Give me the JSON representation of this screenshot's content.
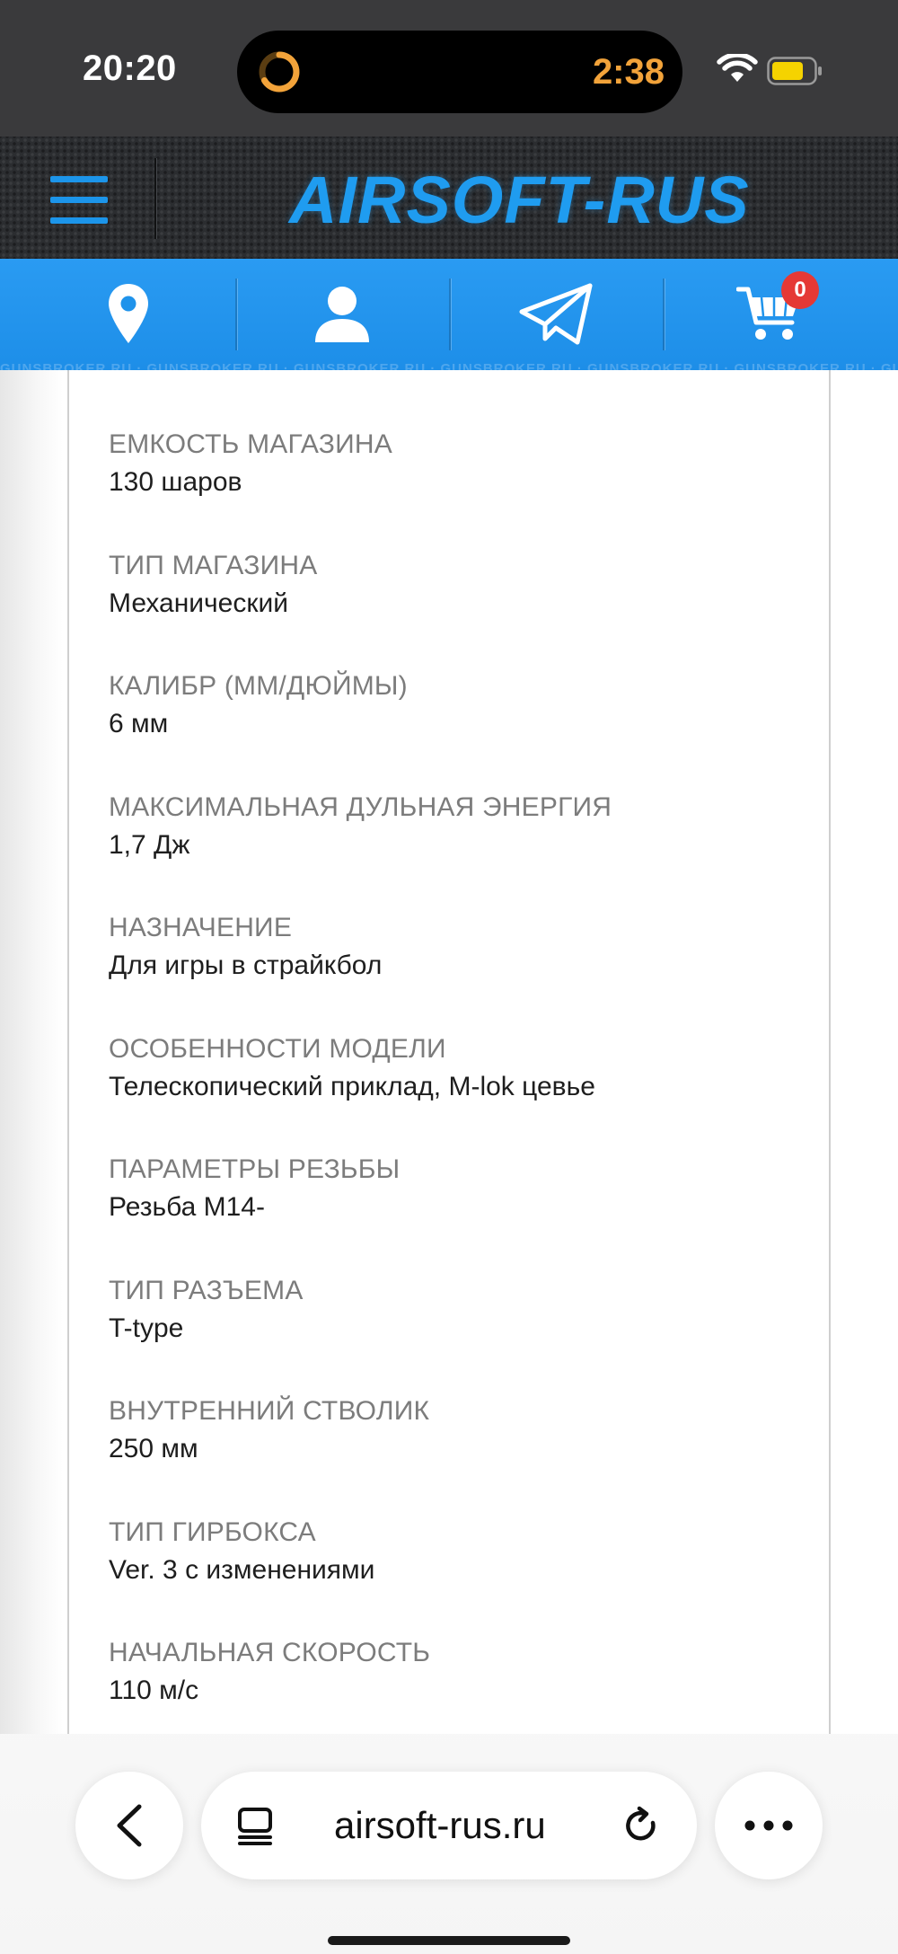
{
  "status_bar": {
    "time": "20:20",
    "island_timer": "2:38",
    "icons": [
      "activity-ring-icon",
      "wifi-icon",
      "battery-icon"
    ]
  },
  "header": {
    "logo": "AIRSOFT-RUS",
    "accent_color": "#1f9cf0",
    "menu_icon": "hamburger-menu-icon"
  },
  "action_bar": {
    "items": [
      {
        "name": "location",
        "icon": "map-pin-icon"
      },
      {
        "name": "account",
        "icon": "user-icon"
      },
      {
        "name": "telegram",
        "icon": "telegram-icon"
      },
      {
        "name": "cart",
        "icon": "cart-icon"
      }
    ],
    "cart_count": "0",
    "watermark": "GUNSBROKER.RU · GUNSBROKER.RU · GUNSBROKER.RU · GUNSBROKER.RU · GUNSBROKER.RU · GUNSBROKER.RU · GUNSBROKER.RU",
    "bar_color": "#1d8ee8",
    "badge_color": "#e53935"
  },
  "specs": [
    {
      "label": "ЕМКОСТЬ МАГАЗИНА",
      "value": "130 шаров"
    },
    {
      "label": "ТИП МАГАЗИНА",
      "value": "Механический"
    },
    {
      "label": "КАЛИБР (ММ/ДЮЙМЫ)",
      "value": "6 мм"
    },
    {
      "label": "МАКСИМАЛЬНАЯ ДУЛЬНАЯ ЭНЕРГИЯ",
      "value": "1,7 Дж"
    },
    {
      "label": "НАЗНАЧЕНИЕ",
      "value": "Для игры в страйкбол"
    },
    {
      "label": "ОСОБЕННОСТИ МОДЕЛИ",
      "value": "Телескопический приклад, M-lok цевье"
    },
    {
      "label": "ПАРАМЕТРЫ РЕЗЬБЫ",
      "value": "Резьба М14-"
    },
    {
      "label": "ТИП РАЗЪЕМА",
      "value": "T-type"
    },
    {
      "label": "ВНУТРЕННИЙ СТВОЛИК",
      "value": "250 мм"
    },
    {
      "label": "ТИП ГИРБОКСА",
      "value": "Ver. 3 с изменениями"
    },
    {
      "label": "НАЧАЛЬНАЯ СКОРОСТЬ",
      "value": "110 м/с"
    }
  ],
  "browser": {
    "url": "airsoft-rus.ru",
    "icons": [
      "back-chevron-icon",
      "tabs-icon",
      "reload-icon",
      "more-icon"
    ]
  }
}
